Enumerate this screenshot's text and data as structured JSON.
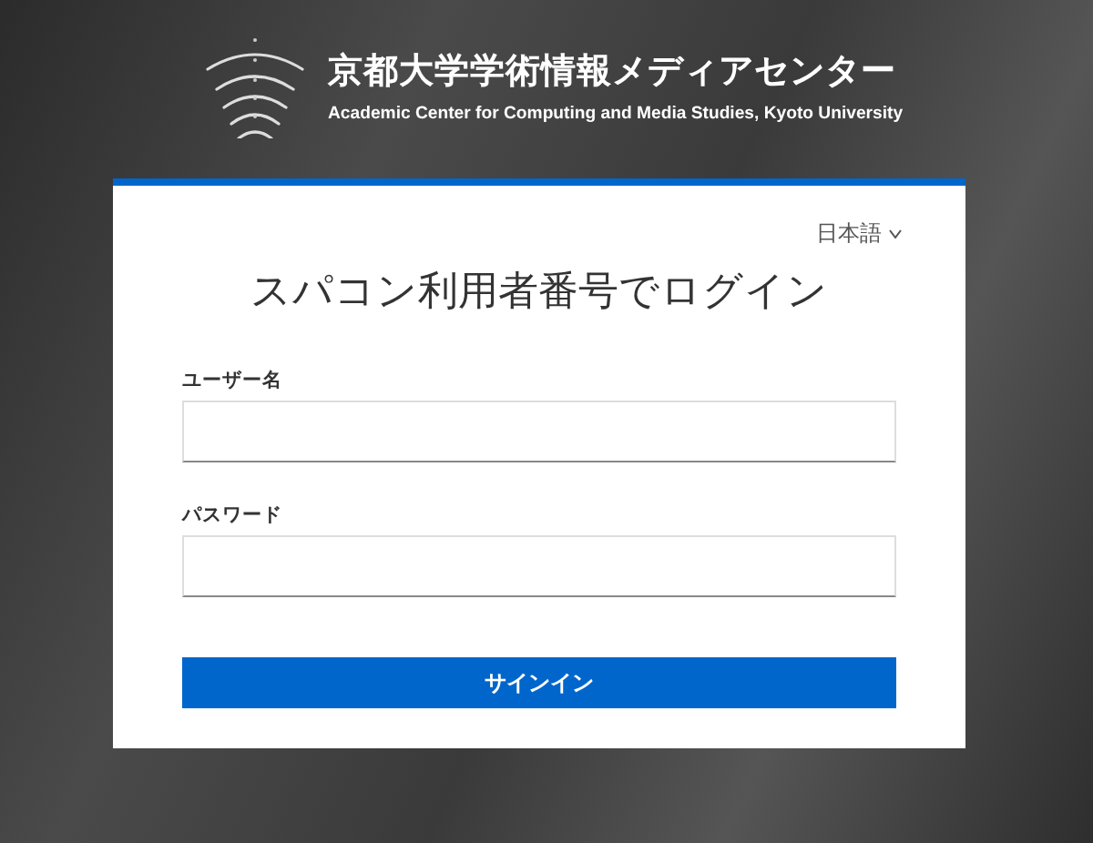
{
  "header": {
    "title": "京都大学学術情報メディアセンター",
    "subtitle": "Academic Center for Computing and Media Studies, Kyoto University"
  },
  "login": {
    "language": "日本語",
    "heading": "スパコン利用者番号でログイン",
    "fields": [
      {
        "label": "ユーザー名"
      },
      {
        "label": "パスワード"
      }
    ],
    "submit": "サインイン"
  }
}
